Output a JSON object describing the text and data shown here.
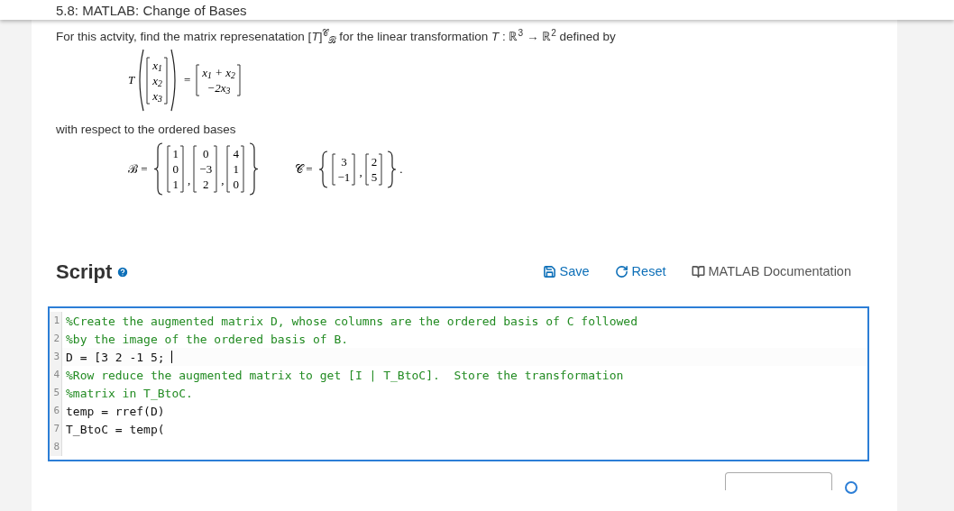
{
  "header": {
    "title": "5.8: MATLAB: Change of Bases"
  },
  "intro": "For this actvity, find the matrix represenatation [*T*]$^{𝒞}$$_{ℬ}$ for the linear transformation *T* : ℝ$^{3}$ → ℝ$^{2}$ defined by",
  "definition": {
    "function": "*T*",
    "input": [
      "x$_{1}$",
      "x$_{2}$",
      "x$_{3}$"
    ],
    "equals": "=",
    "output": [
      "x$_{1}$ + x$_{2}$",
      "−2x$_{3}$"
    ]
  },
  "bases_intro": "with respect to the ordered bases",
  "bases": [
    {
      "symbol": "ℬ =",
      "vectors": [
        [
          "1",
          "0",
          "1"
        ],
        [
          "0",
          "−3",
          "2"
        ],
        [
          "4",
          "1",
          "0"
        ]
      ],
      "separators": [
        ",",
        ","
      ]
    },
    {
      "symbol": "𝒞 =",
      "vectors": [
        [
          "3",
          "−1"
        ],
        [
          "2",
          "5"
        ]
      ],
      "separators": [
        ","
      ],
      "end": "."
    }
  ],
  "script": {
    "title": "Script",
    "actions": [
      {
        "kind": "save",
        "label": "Save"
      },
      {
        "kind": "reset",
        "label": "Reset"
      },
      {
        "kind": "docs",
        "label": "MATLAB Documentation"
      }
    ],
    "lines": [
      {
        "number": "1",
        "kind": "comment",
        "text": "%Create the augmented matrix D, whose columns are the ordered basis of C followed",
        "cursor": false
      },
      {
        "number": "2",
        "kind": "comment",
        "text": "%by the image of the ordered basis of B.",
        "cursor": false
      },
      {
        "number": "3",
        "kind": "code",
        "text": "D = [3 2 -1 5; ",
        "cursor": true
      },
      {
        "number": "4",
        "kind": "comment",
        "text": "%Row reduce the augmented matrix to get [I | T_BtoC].  Store the transformation",
        "cursor": false
      },
      {
        "number": "5",
        "kind": "comment",
        "text": "%matrix in T_BtoC.",
        "cursor": false
      },
      {
        "number": "6",
        "kind": "code",
        "text": "temp = rref(D)",
        "cursor": false
      },
      {
        "number": "7",
        "kind": "code",
        "text": "T_BtoC = temp(",
        "cursor": false
      },
      {
        "number": "8",
        "kind": "code",
        "cursor": false
      }
    ]
  }
}
